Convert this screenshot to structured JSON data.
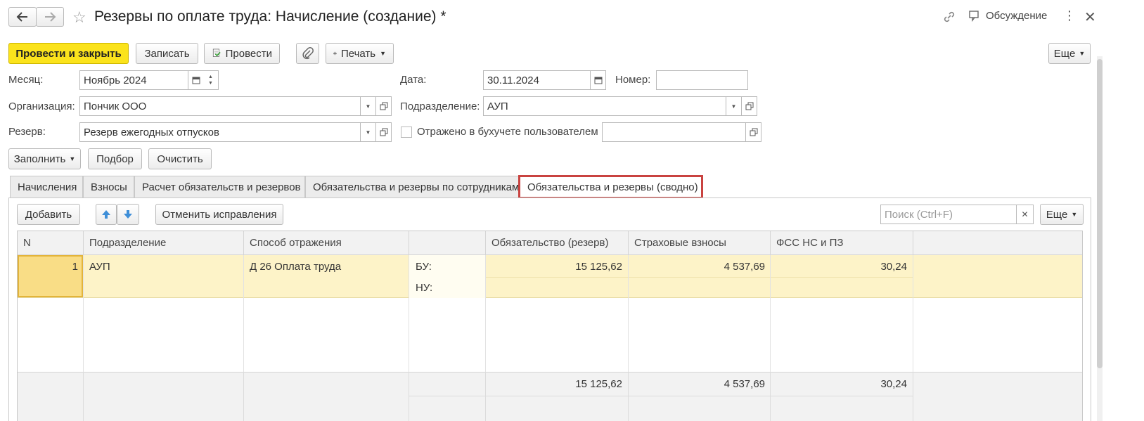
{
  "window": {
    "title": "Резервы по оплате труда: Начисление (создание) *",
    "discussion_label": "Обсуждение"
  },
  "toolbar": {
    "post_and_close": "Провести и закрыть",
    "save": "Записать",
    "post": "Провести",
    "print": "Печать",
    "more": "Еще"
  },
  "form": {
    "month_label": "Месяц:",
    "month_value": "Ноябрь 2024",
    "date_label": "Дата:",
    "date_value": "30.11.2024",
    "number_label": "Номер:",
    "number_value": "",
    "org_label": "Организация:",
    "org_value": "Пончик ООО",
    "subdivision_label": "Подразделение:",
    "subdivision_value": "АУП",
    "reserve_label": "Резерв:",
    "reserve_value": "Резерв ежегодных отпусков",
    "reflected_label": "Отражено в бухучете пользователем",
    "reflected_value": ""
  },
  "fill_toolbar": {
    "fill": "Заполнить",
    "pick": "Подбор",
    "clear": "Очистить"
  },
  "tabs": [
    {
      "label": "Начисления"
    },
    {
      "label": "Взносы"
    },
    {
      "label": "Расчет обязательств и резервов"
    },
    {
      "label": "Обязательства и резервы по сотрудникам"
    },
    {
      "label": "Обязательства и резервы (сводно)"
    }
  ],
  "table_toolbar": {
    "add": "Добавить",
    "cancel_corrections": "Отменить исправления",
    "search_placeholder": "Поиск (Ctrl+F)",
    "more": "Еще"
  },
  "table": {
    "columns": [
      "N",
      "Подразделение",
      "Способ отражения",
      "",
      "Обязательство (резерв)",
      "Страховые взносы",
      "ФСС НС и ПЗ"
    ],
    "rows": [
      {
        "n": "1",
        "subdivision": "АУП",
        "method": "Д 26 Оплата труда",
        "bu_label": "БУ:",
        "nu_label": "НУ:",
        "obligation_bu": "15 125,62",
        "insurance_bu": "4 537,69",
        "fss_bu": "30,24"
      }
    ],
    "totals": {
      "obligation": "15 125,62",
      "insurance": "4 537,69",
      "fss": "30,24"
    }
  },
  "colors": {
    "accent_yellow": "#fbe31c",
    "selected_row": "#fdf3c8",
    "highlight_border": "#c94340"
  }
}
